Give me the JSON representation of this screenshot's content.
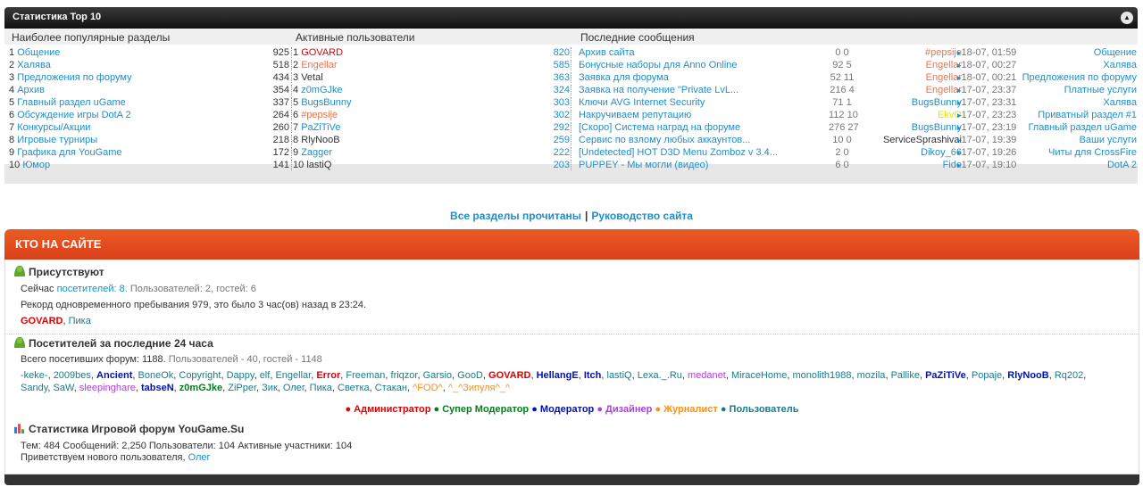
{
  "top10": {
    "title": "Статистика Top 10",
    "columns": [
      "Наиболее популярные разделы",
      "Активные пользователи",
      "Последние сообщения"
    ],
    "popular": [
      {
        "rank": "1",
        "name": "Общение",
        "count": "925"
      },
      {
        "rank": "2",
        "name": "Халява",
        "count": "518"
      },
      {
        "rank": "3",
        "name": "Предложения по форуму",
        "count": "434"
      },
      {
        "rank": "4",
        "name": "Архив",
        "count": "354"
      },
      {
        "rank": "5",
        "name": "Главный раздел uGame",
        "count": "337"
      },
      {
        "rank": "6",
        "name": "Обсуждение игры DotA 2",
        "count": "264"
      },
      {
        "rank": "7",
        "name": "Конкурсы/Акции",
        "count": "260"
      },
      {
        "rank": "8",
        "name": "Игровые турниры",
        "count": "218"
      },
      {
        "rank": "9",
        "name": "Графика для YouGame",
        "count": "172"
      },
      {
        "rank": "10",
        "name": "Юмор",
        "count": "141"
      }
    ],
    "active": [
      {
        "rank": "1",
        "name": "GOVARD",
        "count": "820",
        "color": "red"
      },
      {
        "rank": "2",
        "name": "Engellar",
        "count": "585",
        "color": "orange"
      },
      {
        "rank": "3",
        "name": "Vetal",
        "count": "363",
        "color": "dark"
      },
      {
        "rank": "4",
        "name": "z0mGJke",
        "count": "324",
        "color": "blue"
      },
      {
        "rank": "5",
        "name": "BugsBunny",
        "count": "303",
        "color": "blue"
      },
      {
        "rank": "6",
        "name": "#pepsije",
        "count": "302",
        "color": "orange"
      },
      {
        "rank": "7",
        "name": "PaZiTiVe",
        "count": "292",
        "color": "blue"
      },
      {
        "rank": "8",
        "name": "RlyNooB",
        "count": "259",
        "color": "dark"
      },
      {
        "rank": "9",
        "name": "Zagger",
        "count": "222",
        "color": "blue"
      },
      {
        "rank": "10",
        "name": "lastiQ",
        "count": "203",
        "color": "dark"
      }
    ],
    "latest": [
      {
        "topic": "Архив сайта",
        "stats": "0 0",
        "user": "#pepsije",
        "ucolor": "orange",
        "date": "18-07, 01:59",
        "forum": "Общение"
      },
      {
        "topic": "Бонусные наборы для Anno Online",
        "stats": "92 5",
        "user": "Engellar",
        "ucolor": "orange",
        "date": "18-07, 00:27",
        "forum": "Халява"
      },
      {
        "topic": "Заявка для форума",
        "stats": "52 11",
        "user": "Engellar",
        "ucolor": "orange",
        "date": "18-07, 00:21",
        "forum": "Предложения по форуму"
      },
      {
        "topic": "Заявка на получение \"Private LvL...",
        "stats": "216 4",
        "user": "Engellar",
        "ucolor": "orange",
        "date": "17-07, 23:37",
        "forum": "Платные услуги"
      },
      {
        "topic": "Ключи AVG Internet Security",
        "stats": "71 1",
        "user": "BugsBunny",
        "ucolor": "blue",
        "date": "17-07, 23:31",
        "forum": "Халява"
      },
      {
        "topic": "Накручиваем репутацию",
        "stats": "112 10",
        "user": "EkvO",
        "ucolor": "yellow",
        "date": "17-07, 23:23",
        "forum": "Приватный раздел #1"
      },
      {
        "topic": "[Скоро] Система наград на форуме",
        "stats": "276 27",
        "user": "BugsBunny",
        "ucolor": "blue",
        "date": "17-07, 23:19",
        "forum": "Главный раздел uGame"
      },
      {
        "topic": "Сервис по взлому любых аккаунтов...",
        "stats": "10 0",
        "user": "ServiceSprashivai",
        "ucolor": "dark",
        "date": "17-07, 19:39",
        "forum": "Ваши услуги"
      },
      {
        "topic": "[Undetected] HOT D3D Menu Zomboz v 3.4...",
        "stats": "2 0",
        "user": "Dikoy_66",
        "ucolor": "blue",
        "date": "17-07, 19:26",
        "forum": "Читы для CrossFire"
      },
      {
        "topic": "PUPPEY - Мы могли (видео)",
        "stats": "6 0",
        "user": "Fide",
        "ucolor": "blue",
        "date": "17-07, 19:10",
        "forum": "DotA 2"
      }
    ]
  },
  "links": {
    "all_read": "Все разделы прочитаны",
    "sep": "|",
    "guide": "Руководство сайта"
  },
  "who": {
    "title": "КТО НА САЙТЕ",
    "present_title": "Присутствуют",
    "now_prefix": "Сейчас",
    "now_link": "посетителей: 8.",
    "now_rest": "Пользователей: 2, гостей: 6",
    "record": "Рекорд одновременного пребывания 979, это было 3 час(ов) назад в 23:24.",
    "online_users": [
      {
        "name": "GOVARD",
        "cls": "darkred",
        "sep": ", "
      },
      {
        "name": "Пика",
        "cls": "teal",
        "sep": ""
      }
    ],
    "day_title": "Посетителей за последние 24 часа",
    "day_total": "Всего посетивших форум: 1188.",
    "day_rest": "Пользователей - 40, гостей - 1148",
    "day_users_line1": [
      {
        "name": "-keke-",
        "cls": "teal"
      },
      {
        "name": "2009bes",
        "cls": "teal"
      },
      {
        "name": "Ancient",
        "cls": "navy b"
      },
      {
        "name": "BoneOk",
        "cls": "teal"
      },
      {
        "name": "Copyright",
        "cls": "teal"
      },
      {
        "name": "Dappy",
        "cls": "teal"
      },
      {
        "name": "elf",
        "cls": "teal"
      },
      {
        "name": "Engellar",
        "cls": "teal"
      },
      {
        "name": "Error",
        "cls": "darkred"
      },
      {
        "name": "Freeman",
        "cls": "teal"
      },
      {
        "name": "friqzor",
        "cls": "teal"
      },
      {
        "name": "Garsio",
        "cls": "teal"
      },
      {
        "name": "GooD",
        "cls": "teal"
      },
      {
        "name": "GOVARD",
        "cls": "darkred"
      },
      {
        "name": "HellangE",
        "cls": "navy b"
      },
      {
        "name": "Itch",
        "cls": "navy b"
      },
      {
        "name": "lastiQ",
        "cls": "teal"
      },
      {
        "name": "Lexa._.Ru",
        "cls": "teal"
      },
      {
        "name": "medanet",
        "cls": "purple"
      },
      {
        "name": "MiraceHome",
        "cls": "teal"
      },
      {
        "name": "monolith1988",
        "cls": "teal"
      },
      {
        "name": "mozila",
        "cls": "teal"
      },
      {
        "name": "Pallike",
        "cls": "teal"
      },
      {
        "name": "PaZiTiVe",
        "cls": "navy b"
      },
      {
        "name": "Popaje",
        "cls": "teal"
      },
      {
        "name": "RlyNooB",
        "cls": "navy b"
      },
      {
        "name": "Rq202",
        "cls": "teal"
      }
    ],
    "day_users_line2": [
      {
        "name": "Sandy",
        "cls": "teal"
      },
      {
        "name": "SaW",
        "cls": "teal"
      },
      {
        "name": "sleepinghare",
        "cls": "purple"
      },
      {
        "name": "tabseN",
        "cls": "navy b"
      },
      {
        "name": "z0mGJke",
        "cls": "green b"
      },
      {
        "name": "ZiPper",
        "cls": "teal"
      },
      {
        "name": "Зик",
        "cls": "teal"
      },
      {
        "name": "Олег",
        "cls": "teal"
      },
      {
        "name": "Пика",
        "cls": "teal"
      },
      {
        "name": "Светка",
        "cls": "teal"
      },
      {
        "name": "Стакан",
        "cls": "teal"
      },
      {
        "name": "^FOD^",
        "cls": "lorange"
      },
      {
        "name": "^_^Зипуля^_^",
        "cls": "lorange"
      }
    ],
    "legend": [
      {
        "label": "Администратор",
        "cls": "red"
      },
      {
        "label": "Супер Модератор",
        "cls": "green"
      },
      {
        "label": "Модератор",
        "cls": "navy"
      },
      {
        "label": "Дизайнер",
        "cls": "purple"
      },
      {
        "label": "Журналист",
        "cls": "lorange"
      },
      {
        "label": "Пользователь",
        "cls": "teal"
      }
    ],
    "stats_title": "Статистика Игровой форум YouGame.Su",
    "stats_line": "Тем: 484  Сообщений: 2,250  Пользователи: 104  Активные участники: 104",
    "welcome_prefix": "Приветствуем нового пользователя,",
    "welcome_user": "Олег"
  }
}
